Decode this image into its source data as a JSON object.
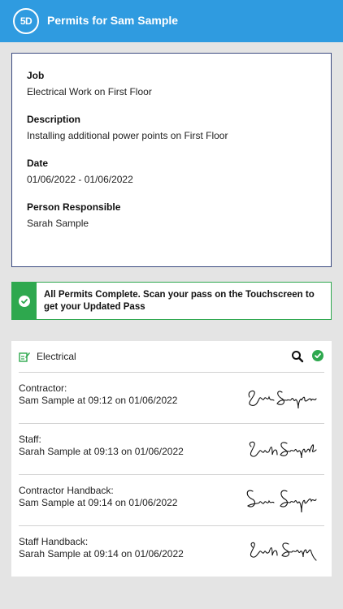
{
  "app": {
    "logo_text": "5D",
    "title": "Permits for Sam Sample"
  },
  "job": {
    "fields": [
      {
        "label": "Job",
        "value": "Electrical Work on First Floor"
      },
      {
        "label": "Description",
        "value": "Installing additional power points on First Floor"
      },
      {
        "label": "Date",
        "value": "01/06/2022 - 01/06/2022"
      },
      {
        "label": "Person Responsible",
        "value": "Sarah Sample"
      }
    ]
  },
  "banner": {
    "text": "All Permits Complete.  Scan your pass on the Touchscreen to get your Updated Pass",
    "accent": "#2ea84e"
  },
  "permit": {
    "title": "Electrical",
    "icons": [
      "edit-document-icon",
      "search-icon",
      "check-circle-icon"
    ],
    "signatures": [
      {
        "role": "Contractor:",
        "detail": "Sam Sample at 09:12 on 01/06/2022",
        "signature": "Sam Sample"
      },
      {
        "role": "Staff:",
        "detail": "Sarah Sample at 09:13 on 01/06/2022",
        "signature": "Sarah Sample"
      },
      {
        "role": "Contractor Handback:",
        "detail": "Sam Sample at 09:14 on 01/06/2022",
        "signature": "Sam Sample"
      },
      {
        "role": "Staff Handback:",
        "detail": "Sarah Sample at 09:14 on 01/06/2022",
        "signature": "Sarah Sample"
      }
    ]
  },
  "colors": {
    "appbar": "#2f9be0",
    "success": "#2ea84e",
    "card_border": "#3b4a80"
  }
}
